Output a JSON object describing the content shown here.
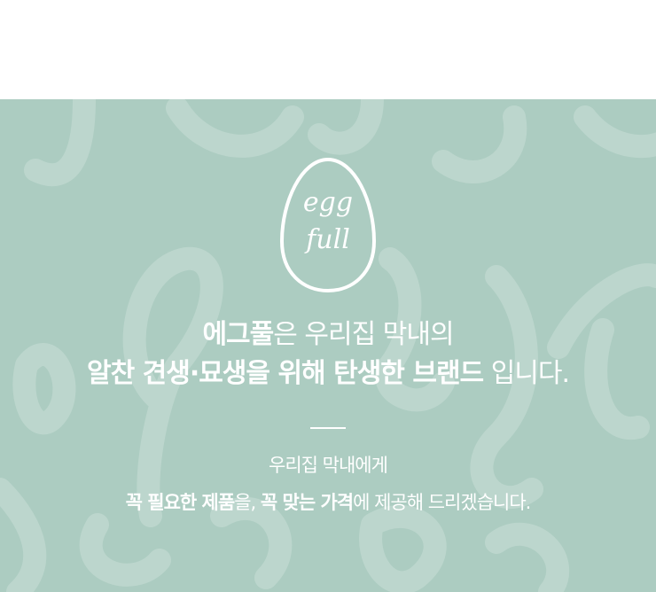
{
  "colors": {
    "banner_bg": "#acccc1",
    "text": "#ffffff"
  },
  "logo": {
    "text_line1": "egg",
    "text_line2": "full"
  },
  "headline": {
    "line1": {
      "brand": "에그풀",
      "rest": "은 우리집 막내의"
    },
    "line2": {
      "bold": "알찬 견생·묘생을 위해 탄생한 브랜드",
      "rest": " 입니다."
    }
  },
  "subtext": {
    "line1": "우리집 막내에게",
    "line2": {
      "part1_bold": "꼭 필요한 제품",
      "part2": "을, ",
      "part3_bold": "꼭 맞는 가격",
      "part4": "에 제공해 드리겠습니다."
    }
  }
}
